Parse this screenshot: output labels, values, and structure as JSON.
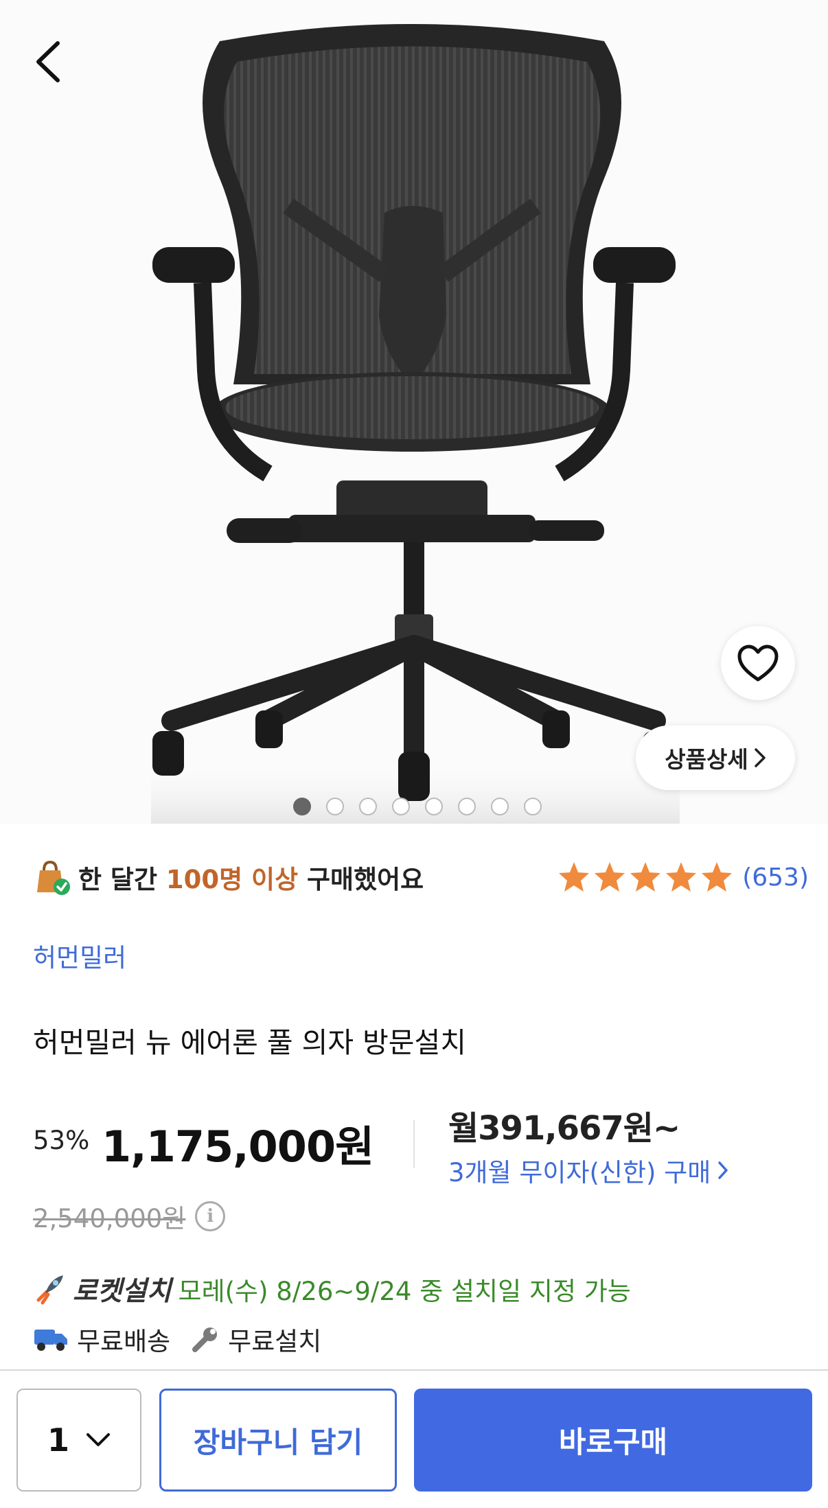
{
  "product_image": {
    "alt": "허먼밀러 뉴 에어론 풀 의자"
  },
  "header": {
    "back_icon": "chevron-left-icon"
  },
  "gallery": {
    "total_images": 8,
    "active_index": 0
  },
  "actions": {
    "wishlist_icon": "heart-outline-icon",
    "detail_label": "상품상세"
  },
  "popular": {
    "prefix": "한 달간 ",
    "highlight": "100명 이상",
    "suffix": " 구매했어요",
    "highlight_color": "#c0652a"
  },
  "rating": {
    "stars": 5,
    "max_stars": 5,
    "count": "(653)",
    "star_color": "#f08a3c"
  },
  "brand": "허먼밀러",
  "title": "허먼밀러 뉴 에어론 풀 의자 방문설치",
  "price": {
    "discount": "53%",
    "sale_price": "1,175,000원",
    "original_price": "2,540,000원",
    "monthly": "월391,667원~",
    "installment": "3개월 무이자(신한) 구매"
  },
  "delivery": {
    "rocket_label": "로켓설치",
    "rocket_text": "모레(수) 8/26~9/24 중 설치일 지정 가능",
    "free_shipping": "무료배송",
    "free_install": "무료설치"
  },
  "bottom_bar": {
    "quantity": "1",
    "cart_label": "장바구니 담기",
    "buy_label": "바로구매",
    "accent": "#4169e1"
  }
}
